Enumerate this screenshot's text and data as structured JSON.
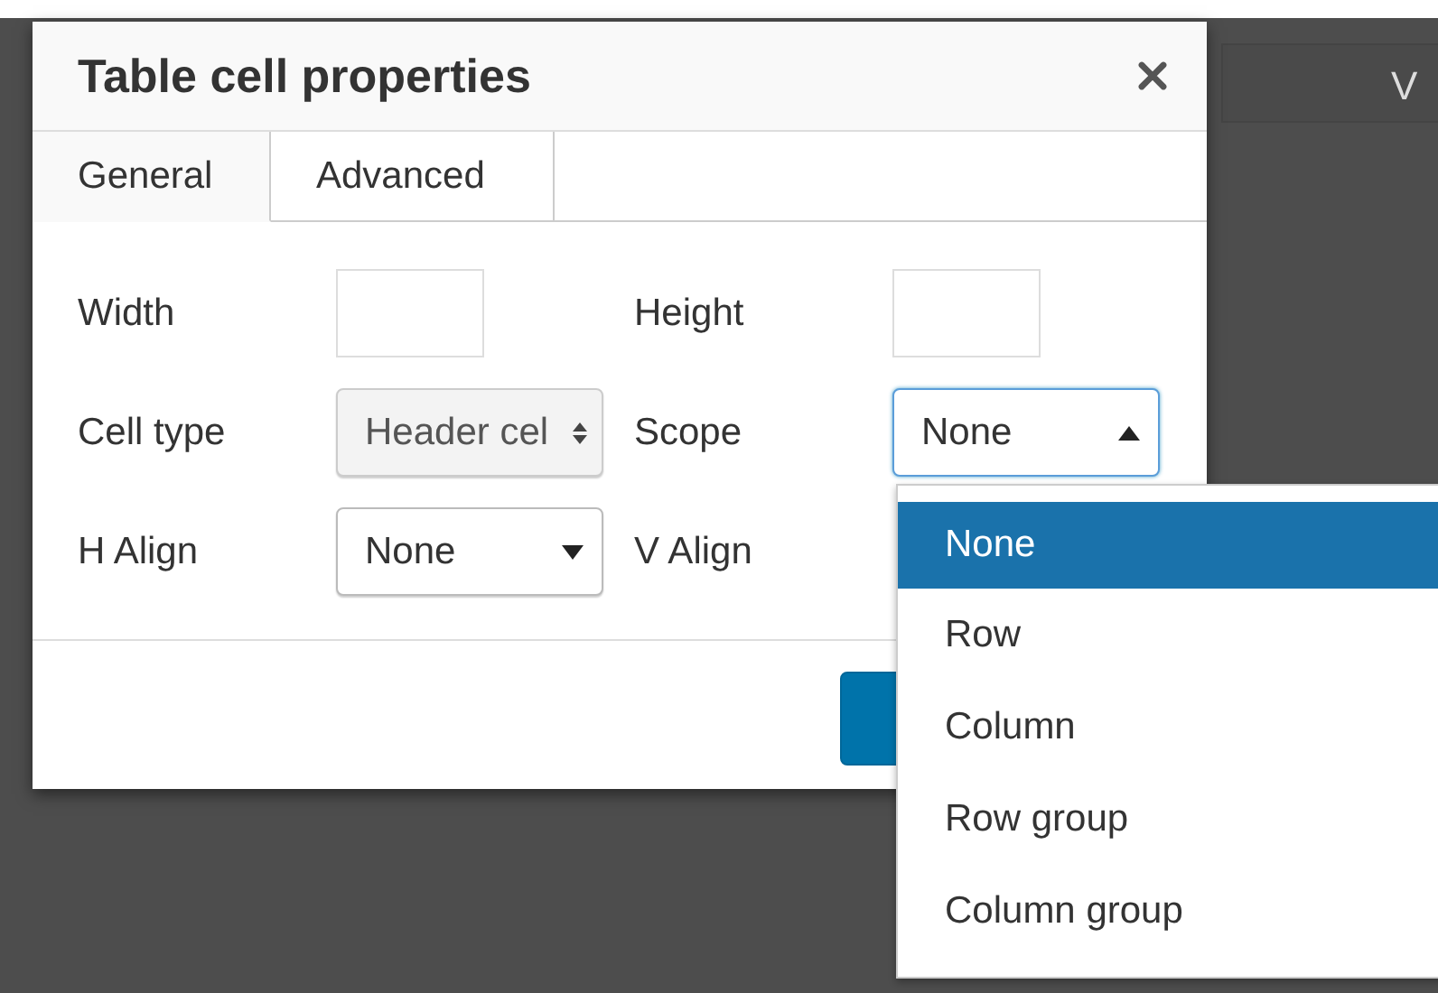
{
  "background": {
    "field_text": "V"
  },
  "dialog": {
    "title": "Table cell properties",
    "tabs": [
      {
        "label": "General",
        "selected": true
      },
      {
        "label": "Advanced",
        "selected": false
      }
    ],
    "fields": [
      {
        "label": "Width",
        "kind": "text"
      },
      {
        "label": "Height",
        "kind": "text"
      },
      {
        "label": "Cell type",
        "kind": "listbox",
        "value": "Header cel",
        "open": false
      },
      {
        "label": "Scope",
        "kind": "select",
        "value": "None",
        "open": true
      },
      {
        "label": "H Align",
        "kind": "select",
        "value": "None",
        "open": false
      },
      {
        "label": "V Align",
        "kind": "hidden"
      }
    ]
  },
  "dropdown": {
    "options": [
      {
        "label": "None",
        "selected": true
      },
      {
        "label": "Row",
        "selected": false
      },
      {
        "label": "Column",
        "selected": false
      },
      {
        "label": "Row group",
        "selected": false
      },
      {
        "label": "Column group",
        "selected": false
      }
    ]
  }
}
